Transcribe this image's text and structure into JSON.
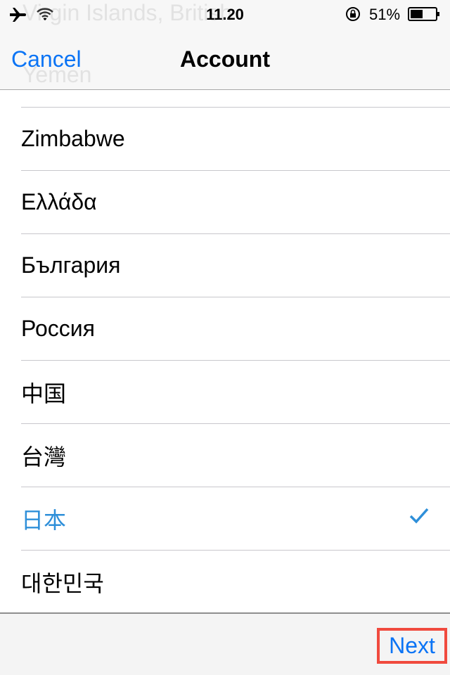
{
  "status_bar": {
    "time": "11.20",
    "battery": "51%",
    "battery_level": 0.51,
    "icons": [
      "airplane-icon",
      "wifi-icon",
      "rotation-lock-icon",
      "battery-icon"
    ]
  },
  "background_scroll": {
    "items": [
      "Virgin Islands, British",
      "Yemen"
    ]
  },
  "nav": {
    "title": "Account",
    "cancel": "Cancel"
  },
  "list": {
    "items": [
      {
        "label": "Zimbabwe",
        "selected": false
      },
      {
        "label": "Ελλάδα",
        "selected": false
      },
      {
        "label": "България",
        "selected": false
      },
      {
        "label": "Россия",
        "selected": false
      },
      {
        "label": "中国",
        "selected": false
      },
      {
        "label": "台灣",
        "selected": false
      },
      {
        "label": "日本",
        "selected": true
      },
      {
        "label": "대한민국",
        "selected": false
      }
    ]
  },
  "toolbar": {
    "next": "Next"
  },
  "colors": {
    "accent": "#0b74f5",
    "selected": "#2e8fd9",
    "highlight": "#f04a3e"
  }
}
